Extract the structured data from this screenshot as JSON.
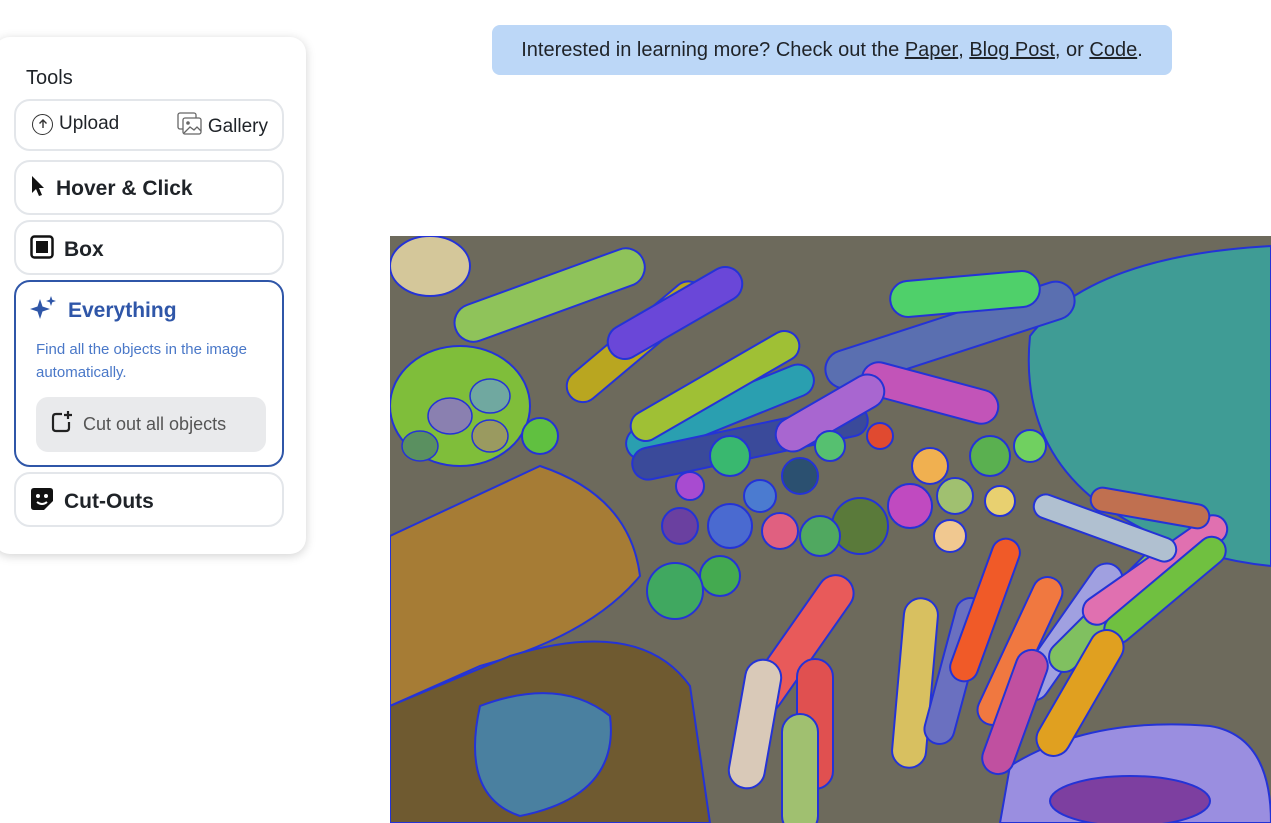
{
  "tools": {
    "title": "Tools",
    "upload_label": "Upload",
    "gallery_label": "Gallery",
    "hover_label": "Hover & Click",
    "box_label": "Box",
    "everything": {
      "label": "Everything",
      "description": "Find all the objects in the image automatically.",
      "cut_button_label": "Cut out all objects"
    },
    "cutouts_label": "Cut-Outs"
  },
  "banner": {
    "prefix": "Interested in learning more? Check out the ",
    "paper_link": "Paper",
    "sep1": ", ",
    "blog_link": "Blog Post",
    "sep2": ", or ",
    "code_link": "Code",
    "suffix": "."
  },
  "colors": {
    "accent": "#2f56a8",
    "banner_bg": "#bcd7f7",
    "mask_outline": "#2433d6"
  },
  "icons": [
    "upload-icon",
    "gallery-icon",
    "cursor-icon",
    "box-icon",
    "sparkle-icon",
    "cut-add-icon",
    "cutouts-icon"
  ]
}
